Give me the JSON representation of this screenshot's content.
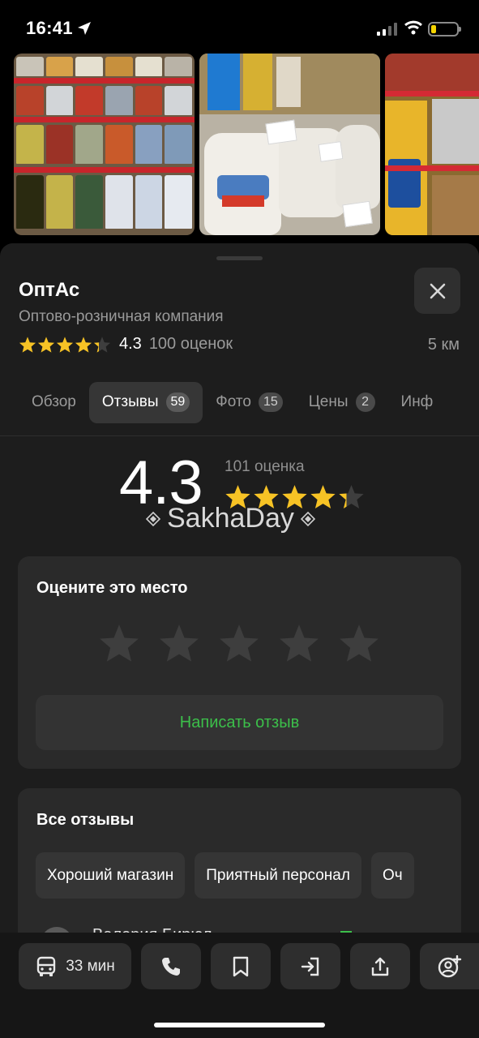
{
  "status_bar": {
    "time": "16:41"
  },
  "place": {
    "name": "ОптАс",
    "category": "Оптово-розничная компания",
    "rating": "4.3",
    "rating_count": "100 оценок",
    "distance": "5 км"
  },
  "tabs": [
    {
      "label": "Обзор",
      "badge": ""
    },
    {
      "label": "Отзывы",
      "badge": "59"
    },
    {
      "label": "Фото",
      "badge": "15"
    },
    {
      "label": "Цены",
      "badge": "2"
    },
    {
      "label": "Инф",
      "badge": ""
    }
  ],
  "summary": {
    "rating": "4.3",
    "count": "101 оценка",
    "stars_value": 4.3,
    "watermark": "SakhaDay"
  },
  "rate_card": {
    "title": "Оцените это место",
    "write_button": "Написать отзыв"
  },
  "reviews_card": {
    "title": "Все отзывы",
    "chips": [
      "Хороший магазин",
      "Приятный персонал",
      "Оч"
    ],
    "first_review_name": "Валерия Бирюл"
  },
  "actions": {
    "route_time": "33 мин"
  },
  "colors": {
    "accent_green": "#3cbf4a",
    "star_yellow": "#f7c325",
    "star_empty": "#3e3e3e"
  }
}
